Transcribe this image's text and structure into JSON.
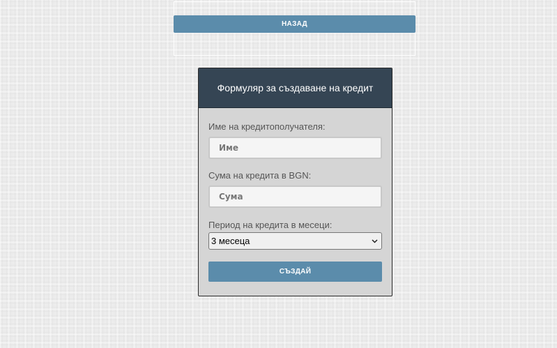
{
  "top_panel": {
    "back_label": "НАЗАД"
  },
  "form": {
    "title": "Формуляр за създаване на кредит",
    "name_label": "Име на кредитополучателя:",
    "name_placeholder": "Име",
    "name_value": "",
    "amount_label": "Сума на кредита в BGN:",
    "amount_placeholder": "Сума",
    "amount_value": "",
    "period_label": "Период на кредита в месеци:",
    "period_selected": "3 месеца",
    "submit_label": "СЪЗДАЙ"
  },
  "colors": {
    "button_blue": "#5b8cab",
    "header_dark": "#354554",
    "card_bg": "#d5d5d5"
  },
  "icons": {
    "select_arrow": "chevron-down-icon"
  }
}
